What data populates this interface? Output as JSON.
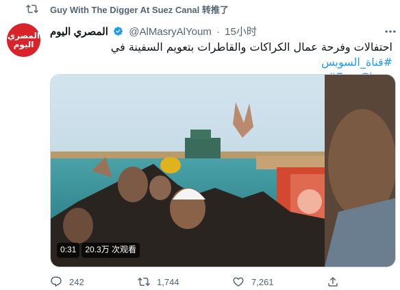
{
  "retweet": {
    "text": "Guy With The Digger At Suez Canal 转推了"
  },
  "avatar": {
    "logo_line1": "المصري",
    "logo_line2": "اليوم"
  },
  "tweet": {
    "display_name": "المصري اليوم",
    "handle": "@AlMasryAlYoum",
    "separator": "·",
    "time": "15小时",
    "text_line1_hashtag": "#قناة_السويس",
    "text_line1_body": "احتفالات وفرحة عمال الكراكات والقاطرات بتعويم السفينة في",
    "text_line2_hashtag": "#EverGiven"
  },
  "media": {
    "duration": "0:31",
    "views": "20.3万 次观看"
  },
  "actions": {
    "reply_count": "242",
    "retweet_count": "1,744",
    "like_count": "7,261"
  },
  "colors": {
    "accent": "#1d9bf0",
    "secondary_text": "#536471",
    "avatar_red": "#d8232a"
  },
  "icons": {
    "retweet_header": "retweet-icon",
    "verified": "verified-badge-icon",
    "more": "more-icon",
    "reply": "reply-icon",
    "retweet": "retweet-icon",
    "like": "heart-icon",
    "share": "share-icon"
  }
}
